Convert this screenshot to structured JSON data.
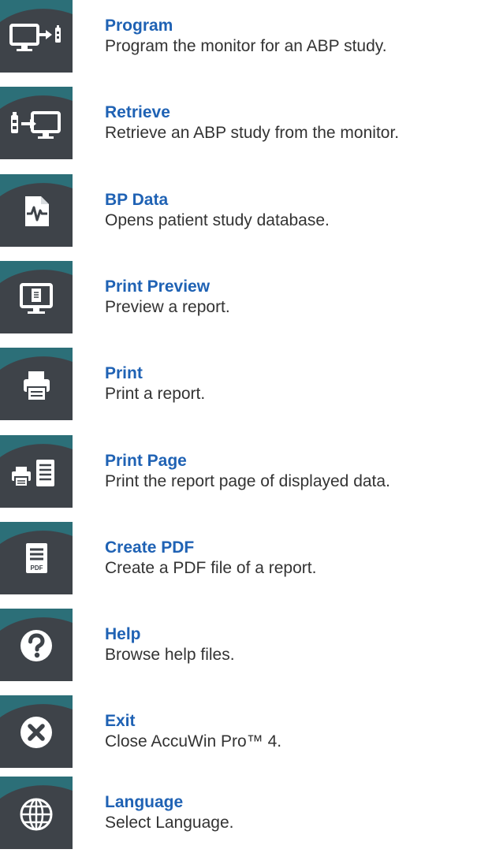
{
  "menu": {
    "items": [
      {
        "title": "Program",
        "description": "Program the monitor for an ABP study.",
        "icon": "monitor-program-icon"
      },
      {
        "title": "Retrieve",
        "description": "Retrieve an ABP study from the monitor.",
        "icon": "monitor-retrieve-icon"
      },
      {
        "title": "BP Data",
        "description": "Opens patient study database.",
        "icon": "bp-data-icon"
      },
      {
        "title": "Print Preview",
        "description": "Preview a report.",
        "icon": "print-preview-icon"
      },
      {
        "title": "Print",
        "description": "Print a report.",
        "icon": "printer-icon"
      },
      {
        "title": "Print Page",
        "description": "Print the report page of displayed data.",
        "icon": "print-page-icon"
      },
      {
        "title": "Create PDF",
        "description": "Create a PDF file of a report.",
        "icon": "pdf-icon"
      },
      {
        "title": "Help",
        "description": "Browse help files.",
        "icon": "help-icon"
      },
      {
        "title": "Exit",
        "description": "Close AccuWin Pro™ 4.",
        "icon": "close-icon"
      },
      {
        "title": "Language",
        "description": "Select Language.",
        "icon": "globe-icon"
      }
    ],
    "pdf_icon_text": "PDF"
  },
  "colors": {
    "tile": "#3e4349",
    "tile_accent": "#2c6f78",
    "title": "#1f62b4",
    "description": "#333333"
  }
}
